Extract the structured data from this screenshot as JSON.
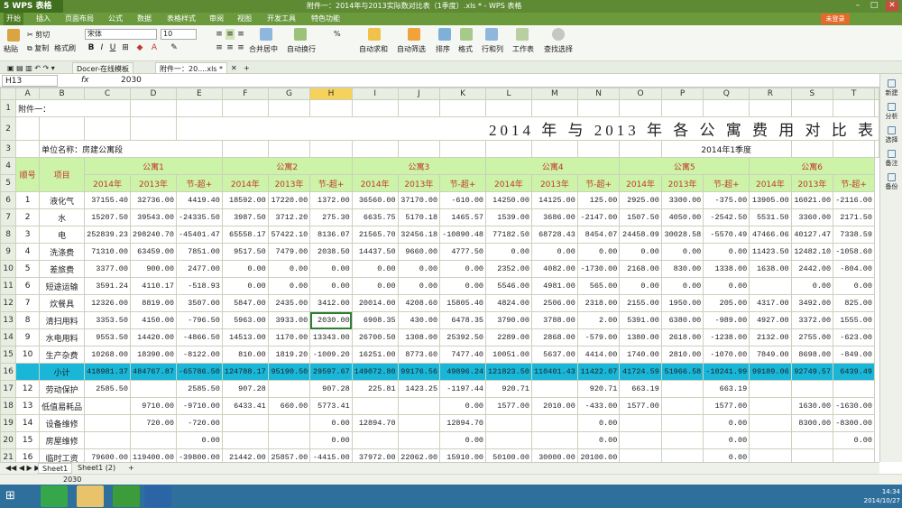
{
  "app": {
    "wps_button": "5 WPS 表格",
    "title": "附件一：2014年与2013实际数对比表（1季度）.xls * - WPS 表格",
    "login": "未登录"
  },
  "menu": [
    "开始",
    "插入",
    "页面布局",
    "公式",
    "数据",
    "表格样式",
    "审阅",
    "视图",
    "开发工具",
    "特色功能"
  ],
  "ribbon": {
    "paste": "粘贴",
    "cut": "剪切",
    "copy": "复制",
    "format_painter": "格式刷",
    "font": "宋体",
    "size": "10",
    "merge": "合并居中",
    "wrap": "自动换行",
    "percent": "%",
    "autosum": "自动求和",
    "autofilter": "自动筛选",
    "sort": "排序",
    "format": "格式",
    "rowcol": "行和列",
    "sheet": "工作表",
    "find": "查找选择"
  },
  "doctabs": [
    "Docer-在线模板",
    "附件一：20....xls *"
  ],
  "formula": {
    "cell": "H13",
    "fx": "fx",
    "value": "2030"
  },
  "sidebar": [
    "新建",
    "分析",
    "选择",
    "备注",
    "备份"
  ],
  "columns": [
    "A",
    "B",
    "C",
    "D",
    "E",
    "F",
    "G",
    "H",
    "I",
    "J",
    "K",
    "L",
    "M",
    "N",
    "O",
    "P",
    "Q",
    "R",
    "S",
    "T"
  ],
  "sheet": {
    "attach": "附件一：",
    "title": "2014 年 与 2013 年 各 公 寓 费 用 对 比 表",
    "unit": "单位名称：房建公寓段",
    "quarter": "2014年1季度",
    "seq": "顺号",
    "item": "项目",
    "groups": [
      "公寓1",
      "公寓2",
      "公寓3",
      "公寓4",
      "公寓5",
      "公寓6"
    ],
    "subheads": [
      "2014年",
      "2013年",
      "节-超+"
    ],
    "rows": [
      {
        "r": "6",
        "seq": "1",
        "item": "液化气",
        "v": [
          "37155.40",
          "32736.00",
          "4419.40",
          "18592.00",
          "17220.00",
          "1372.00",
          "36560.00",
          "37170.00",
          "-610.00",
          "14250.00",
          "14125.00",
          "125.00",
          "2925.00",
          "3300.00",
          "-375.00",
          "13905.00",
          "16021.00",
          "-2116.00"
        ]
      },
      {
        "r": "7",
        "seq": "2",
        "item": "水",
        "v": [
          "15207.50",
          "39543.00",
          "-24335.50",
          "3987.50",
          "3712.20",
          "275.30",
          "6635.75",
          "5170.18",
          "1465.57",
          "1539.00",
          "3686.00",
          "-2147.00",
          "1507.50",
          "4050.00",
          "-2542.50",
          "5531.50",
          "3360.00",
          "2171.50"
        ]
      },
      {
        "r": "8",
        "seq": "3",
        "item": "电",
        "v": [
          "252839.23",
          "298240.70",
          "-45401.47",
          "65558.17",
          "57422.10",
          "8136.07",
          "21565.70",
          "32456.18",
          "-10890.48",
          "77182.50",
          "68728.43",
          "8454.07",
          "24458.09",
          "30028.58",
          "-5570.49",
          "47466.06",
          "40127.47",
          "7338.59"
        ]
      },
      {
        "r": "9",
        "seq": "4",
        "item": "洗涤费",
        "v": [
          "71310.00",
          "63459.00",
          "7851.00",
          "9517.50",
          "7479.00",
          "2038.50",
          "14437.50",
          "9660.00",
          "4777.50",
          "0.00",
          "0.00",
          "0.00",
          "0.00",
          "0.00",
          "0.00",
          "11423.50",
          "12482.10",
          "-1058.60"
        ]
      },
      {
        "r": "10",
        "seq": "5",
        "item": "差旅费",
        "v": [
          "3377.00",
          "900.00",
          "2477.00",
          "0.00",
          "0.00",
          "0.00",
          "0.00",
          "0.00",
          "0.00",
          "2352.00",
          "4082.00",
          "-1730.00",
          "2168.00",
          "830.00",
          "1338.00",
          "1638.00",
          "2442.00",
          "-804.00"
        ]
      },
      {
        "r": "11",
        "seq": "6",
        "item": "短途运输",
        "v": [
          "3591.24",
          "4110.17",
          "-518.93",
          "0.00",
          "0.00",
          "0.00",
          "0.00",
          "0.00",
          "0.00",
          "5546.00",
          "4981.00",
          "565.00",
          "0.00",
          "0.00",
          "0.00",
          "",
          "0.00",
          "0.00"
        ]
      },
      {
        "r": "12",
        "seq": "7",
        "item": "炊餐具",
        "v": [
          "12326.00",
          "8819.00",
          "3507.00",
          "5847.00",
          "2435.00",
          "3412.00",
          "20014.00",
          "4208.60",
          "15805.40",
          "4824.00",
          "2506.00",
          "2318.00",
          "2155.00",
          "1950.00",
          "205.00",
          "4317.00",
          "3492.00",
          "825.00"
        ]
      },
      {
        "r": "13",
        "seq": "8",
        "item": "清扫用料",
        "v": [
          "3353.50",
          "4150.00",
          "-796.50",
          "5963.00",
          "3933.00",
          "2030.00",
          "6908.35",
          "430.00",
          "6478.35",
          "3790.00",
          "3788.00",
          "2.00",
          "5391.00",
          "6380.00",
          "-989.00",
          "4927.00",
          "3372.00",
          "1555.00"
        ]
      },
      {
        "r": "14",
        "seq": "9",
        "item": "水电用料",
        "v": [
          "9553.50",
          "14420.00",
          "-4866.50",
          "14513.00",
          "1170.00",
          "13343.00",
          "26700.50",
          "1308.00",
          "25392.50",
          "2289.00",
          "2868.00",
          "-579.00",
          "1380.00",
          "2618.00",
          "-1238.00",
          "2132.00",
          "2755.00",
          "-623.00"
        ]
      },
      {
        "r": "15",
        "seq": "10",
        "item": "生产杂费",
        "v": [
          "10268.00",
          "18390.00",
          "-8122.00",
          "810.00",
          "1819.20",
          "-1009.20",
          "16251.00",
          "8773.60",
          "7477.40",
          "10051.00",
          "5637.00",
          "4414.00",
          "1740.00",
          "2810.00",
          "-1070.00",
          "7849.00",
          "8698.00",
          "-849.00"
        ]
      },
      {
        "r": "16",
        "seq": "",
        "item": "小计",
        "sub": true,
        "v": [
          "418981.37",
          "484767.87",
          "-65786.50",
          "124788.17",
          "95190.50",
          "29597.67",
          "149072.80",
          "99176.56",
          "49896.24",
          "121823.50",
          "110401.43",
          "11422.07",
          "41724.59",
          "51966.58",
          "-10241.99",
          "99189.06",
          "92749.57",
          "6439.49"
        ]
      },
      {
        "r": "17",
        "seq": "12",
        "item": "劳动保护",
        "v": [
          "2585.50",
          "",
          "2585.50",
          "907.28",
          "",
          "907.28",
          "225.81",
          "1423.25",
          "-1197.44",
          "920.71",
          "",
          "920.71",
          "663.19",
          "",
          "663.19",
          "",
          "",
          ""
        ]
      },
      {
        "r": "18",
        "seq": "13",
        "item": "低值易耗品",
        "v": [
          "",
          "9710.00",
          "-9710.00",
          "6433.41",
          "660.00",
          "5773.41",
          "",
          "",
          "0.00",
          "1577.00",
          "2010.00",
          "-433.00",
          "1577.00",
          "",
          "1577.00",
          "",
          "1630.00",
          "-1630.00"
        ]
      },
      {
        "r": "19",
        "seq": "14",
        "item": "设备维修",
        "v": [
          "",
          "720.00",
          "-720.00",
          "",
          "",
          "0.00",
          "12894.70",
          "",
          "12894.70",
          "",
          "",
          "0.00",
          "",
          "",
          "0.00",
          "",
          "8300.00",
          "-8300.00"
        ]
      },
      {
        "r": "20",
        "seq": "15",
        "item": "房屋维修",
        "v": [
          "",
          "",
          "0.00",
          "",
          "",
          "0.00",
          "",
          "",
          "0.00",
          "",
          "",
          "0.00",
          "",
          "",
          "0.00",
          "",
          "",
          "0.00"
        ]
      },
      {
        "r": "21",
        "seq": "16",
        "item": "临时工资",
        "v": [
          "79600.00",
          "119400.00",
          "-39800.00",
          "21442.00",
          "25857.00",
          "-4415.00",
          "37972.00",
          "22062.00",
          "15910.00",
          "50100.00",
          "30000.00",
          "20100.00",
          "",
          "",
          "0.00",
          "",
          "",
          ""
        ]
      }
    ]
  },
  "sheet_tabs": [
    "Sheet1",
    "Sheet1 (2)",
    "+"
  ],
  "status": {
    "value": "2030"
  },
  "clock": {
    "time": "14:34",
    "date": "2014/10/27"
  }
}
